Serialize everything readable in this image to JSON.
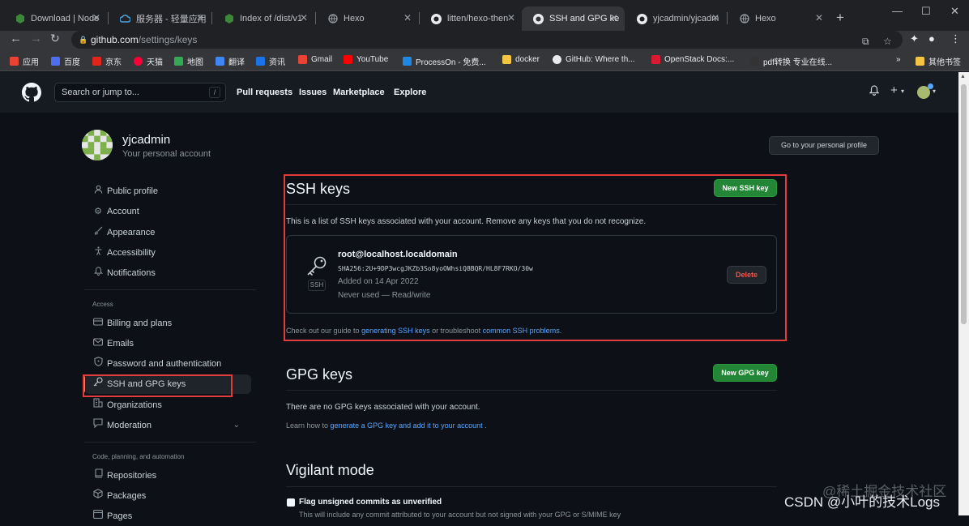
{
  "browser": {
    "tabs": [
      {
        "label": "Download | Node",
        "icon": "node-icon",
        "color": "#3c873a"
      },
      {
        "label": "服务器 - 轻量应用",
        "icon": "cloud-icon",
        "color": "#4aa3df"
      },
      {
        "label": "Index of /dist/v1",
        "icon": "node-icon",
        "color": "#3c873a"
      },
      {
        "label": "Hexo",
        "icon": "globe-icon",
        "color": "#9aa0a6"
      },
      {
        "label": "litten/hexo-then",
        "icon": "github-icon",
        "color": "#e8eaed"
      },
      {
        "label": "SSH and GPG ke",
        "icon": "github-icon",
        "color": "#e8eaed",
        "active": true
      },
      {
        "label": "yjcadmin/yjcadm",
        "icon": "github-icon",
        "color": "#e8eaed"
      },
      {
        "label": "Hexo",
        "icon": "globe-icon",
        "color": "#9aa0a6"
      }
    ],
    "url_host": "github.com",
    "url_path": "/settings/keys",
    "bookmarks": [
      {
        "label": "应用",
        "color": "#ea4335"
      },
      {
        "label": "百度",
        "color": "#4e6ef2"
      },
      {
        "label": "京东",
        "color": "#e1251b"
      },
      {
        "label": "天猫",
        "color": "#ff0036"
      },
      {
        "label": "地图",
        "color": "#34a853"
      },
      {
        "label": "翻译",
        "color": "#4285f4"
      },
      {
        "label": "资讯",
        "color": "#1a73e8"
      },
      {
        "label": "Gmail",
        "color": "#ea4335"
      },
      {
        "label": "YouTube",
        "color": "#ff0000"
      },
      {
        "label": "ProcessOn - 免费...",
        "color": "#1e88e5"
      },
      {
        "label": "docker",
        "color": "#f4c542"
      },
      {
        "label": "GitHub: Where th...",
        "color": "#e8eaed"
      },
      {
        "label": "OpenStack Docs:...",
        "color": "#da1a32"
      },
      {
        "label": "pdf转换 专业在线...",
        "color": "#333333"
      }
    ],
    "bookmarks_more": "»",
    "bookmarks_other": "其他书签"
  },
  "header": {
    "search_placeholder": "Search or jump to...",
    "search_key": "/",
    "nav": [
      "Pull requests",
      "Issues",
      "Marketplace",
      "Explore"
    ]
  },
  "profile": {
    "name": "yjcadmin",
    "subtitle": "Your personal account",
    "goto_label": "Go to your personal profile"
  },
  "sidebar": {
    "top_items": [
      {
        "label": "Public profile",
        "icon": "person-icon"
      },
      {
        "label": "Account",
        "icon": "gear-icon"
      },
      {
        "label": "Appearance",
        "icon": "paintbrush-icon"
      },
      {
        "label": "Accessibility",
        "icon": "accessibility-icon"
      },
      {
        "label": "Notifications",
        "icon": "bell-icon"
      }
    ],
    "access_heading": "Access",
    "access_items": [
      {
        "label": "Billing and plans",
        "icon": "credit-card-icon"
      },
      {
        "label": "Emails",
        "icon": "mail-icon"
      },
      {
        "label": "Password and authentication",
        "icon": "shield-lock-icon"
      },
      {
        "label": "SSH and GPG keys",
        "icon": "key-icon",
        "active": true
      },
      {
        "label": "Organizations",
        "icon": "organization-icon"
      },
      {
        "label": "Moderation",
        "icon": "report-icon"
      }
    ],
    "code_heading": "Code, planning, and automation",
    "code_items": [
      {
        "label": "Repositories",
        "icon": "repo-icon"
      },
      {
        "label": "Packages",
        "icon": "package-icon"
      },
      {
        "label": "Pages",
        "icon": "browser-icon"
      }
    ]
  },
  "ssh": {
    "title": "SSH keys",
    "new_button": "New SSH key",
    "description": "This is a list of SSH keys associated with your account. Remove any keys that you do not recognize.",
    "key": {
      "title": "root@localhost.localdomain",
      "fingerprint": "SHA256:2U+9DP3wcgJKZb3So8yoOWhsiQ8BQR/HL8F7RKO/30w",
      "added": "Added on 14 Apr 2022",
      "usage": "Never used — Read/write",
      "badge": "SSH",
      "delete_label": "Delete"
    },
    "guide_prefix": "Check out our guide to ",
    "guide_link1": "generating SSH keys",
    "guide_mid": " or troubleshoot ",
    "guide_link2": "common SSH problems",
    "guide_suffix": "."
  },
  "gpg": {
    "title": "GPG keys",
    "new_button": "New GPG key",
    "description": "There are no GPG keys associated with your account.",
    "learn_prefix": "Learn how to ",
    "learn_link": "generate a GPG key and add it to your account",
    "learn_suffix": " ."
  },
  "vigilant": {
    "title": "Vigilant mode",
    "checkbox_label": "Flag unsigned commits as unverified",
    "cut_text": "This will include any commit attributed to your account but not signed with your GPG or S/MIME key"
  },
  "watermark": {
    "line1": "@稀土掘金技术社区",
    "line2": "CSDN @小叶的技术Logs"
  }
}
